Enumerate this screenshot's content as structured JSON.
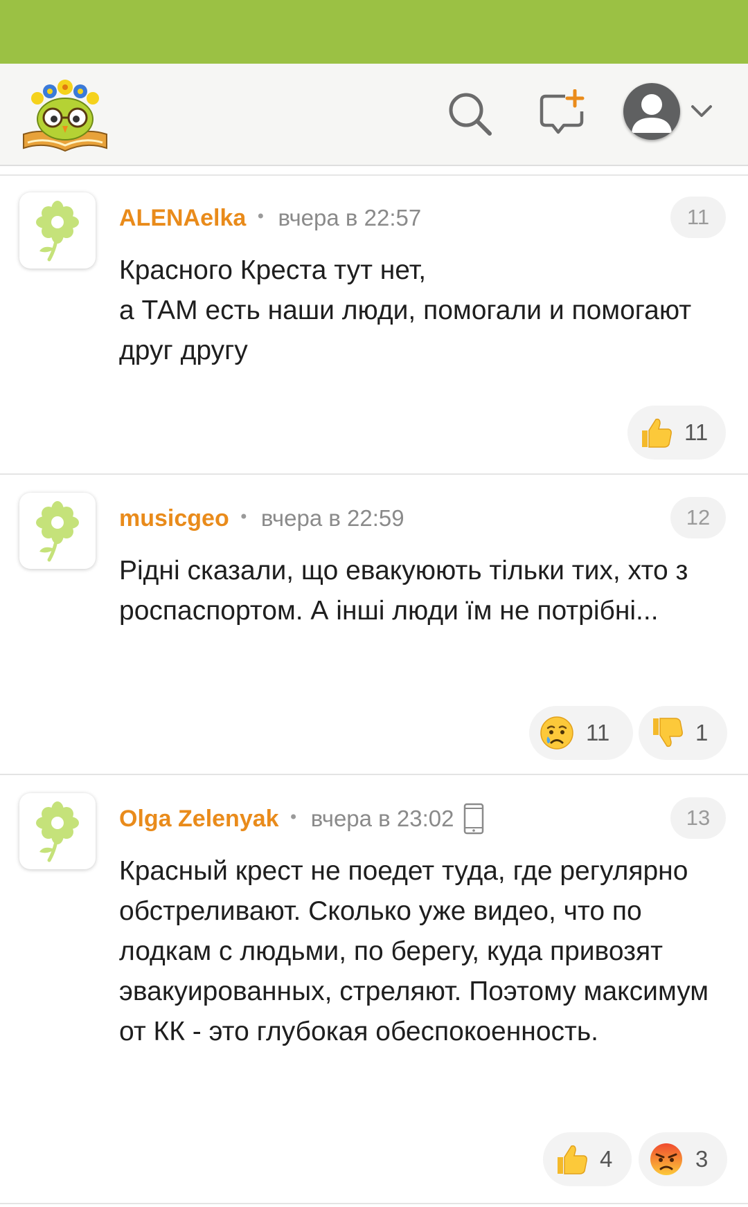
{
  "header": {
    "logo_icon": "owl-reading-book-logo",
    "search_icon": "search-icon",
    "new_post_icon": "new-comment-icon",
    "profile_icon": "user-avatar-icon",
    "menu_icon": "chevron-down-icon"
  },
  "colors": {
    "status_bar": "#9bc144",
    "author": "#e98b1b",
    "header_bg": "#f6f6f4"
  },
  "comments": [
    {
      "author": "ALENAelka",
      "separator": "•",
      "time": "вчера в 22:57",
      "number": "11",
      "text": "Красного Креста тут нет,\nа ТАМ есть наши люди, помогали и помогают друг другу",
      "reactions": [
        {
          "emoji": "thumbs-up-icon",
          "count": "11"
        }
      ]
    },
    {
      "author": "musicgeo",
      "separator": "•",
      "time": "вчера в 22:59",
      "number": "12",
      "text": "Рідні сказали, що евакуюють тільки тих, хто з роспаспортом. А інші люди їм не потрібні...",
      "reactions": [
        {
          "emoji": "crying-face-icon",
          "count": "11"
        },
        {
          "emoji": "thumbs-down-icon",
          "count": "1"
        }
      ]
    },
    {
      "author": "Olga Zelenyak",
      "separator": "•",
      "time": "вчера в 23:02",
      "device_icon": "mobile-phone-icon",
      "number": "13",
      "text": "Красный крест не поедет туда, где регулярно обстреливают. Сколько уже видео, что по лодкам с людьми, по берегу, куда привозят эвакуированных, стреляют. Поэтому максимум от КК - это глубокая обеспокоенность.",
      "reactions": [
        {
          "emoji": "thumbs-up-icon",
          "count": "4"
        },
        {
          "emoji": "angry-face-icon",
          "count": "3"
        }
      ]
    }
  ]
}
